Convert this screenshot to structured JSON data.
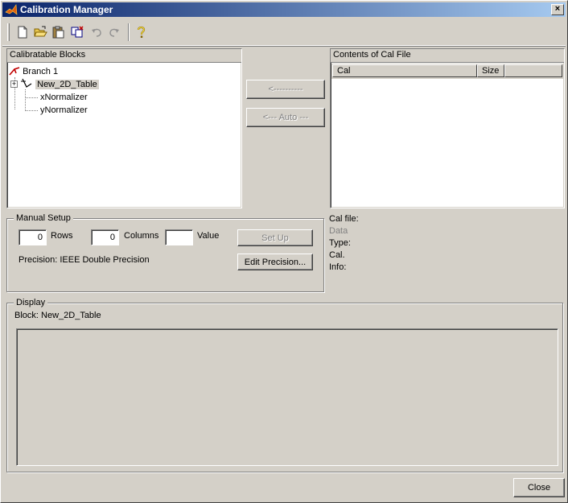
{
  "window": {
    "title": "Calibration Manager",
    "close_glyph": "×"
  },
  "toolbar": {
    "buttons": [
      {
        "name": "new-file",
        "icon": "new-file-icon",
        "enabled": true
      },
      {
        "name": "open-folder",
        "icon": "open-folder-icon",
        "enabled": true
      },
      {
        "name": "paste",
        "icon": "clipboard-icon",
        "enabled": true
      },
      {
        "name": "duplicate",
        "icon": "duplicate-icon",
        "enabled": true
      },
      {
        "name": "undo",
        "icon": "undo-icon",
        "enabled": false
      },
      {
        "name": "redo",
        "icon": "redo-icon",
        "enabled": false
      },
      {
        "name": "help",
        "icon": "help-icon",
        "enabled": true
      }
    ]
  },
  "blocks_panel": {
    "title": "Calibratable Blocks",
    "tree": {
      "root": "Branch 1",
      "items": [
        "New_2D_Table",
        "xNormalizer",
        "yNormalizer"
      ],
      "selected": "New_2D_Table"
    }
  },
  "transfer": {
    "arrow_label": "<----------",
    "auto_label": "<--- Auto ---"
  },
  "cal_panel": {
    "title": "Contents of Cal File",
    "columns": [
      "Cal",
      "Size"
    ]
  },
  "manual_setup": {
    "title": "Manual Setup",
    "rows_value": "0",
    "rows_label": "Rows",
    "columns_value": "0",
    "columns_label": "Columns",
    "value_value": "",
    "value_label": "Value",
    "setup_button": "Set Up",
    "precision_text": "Precision: IEEE Double Precision",
    "edit_precision_button": "Edit Precision..."
  },
  "cal_info": {
    "cal_file": "Cal file:",
    "data": "Data",
    "type": "Type:",
    "cal": "Cal.",
    "info": "Info:"
  },
  "display": {
    "title": "Display",
    "block_text": "Block: New_2D_Table"
  },
  "footer": {
    "close_button": "Close"
  },
  "colors": {
    "titlebar_start": "#0a246a",
    "titlebar_end": "#a6caf0",
    "face": "#d4d0c8"
  }
}
